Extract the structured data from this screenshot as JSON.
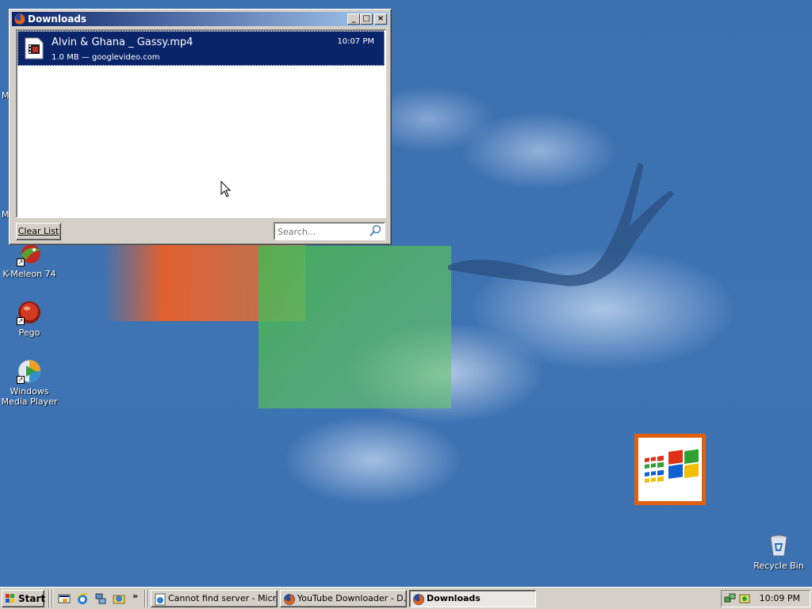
{
  "window": {
    "title": "Downloads",
    "controls": {
      "minimize": "_",
      "maximize": "□",
      "close": "×"
    },
    "download": {
      "filename": "Alvin & Ghana _ Gassy.mp4",
      "meta": "1.0 MB — googlevideo.com",
      "time": "10:07 PM"
    },
    "clear_button": "Clear List",
    "search_placeholder": "Search..."
  },
  "desktop_icons": [
    {
      "label": "K-Meleon 74",
      "icon": "k-meleon-icon"
    },
    {
      "label": "Pego",
      "icon": "pego-icon"
    },
    {
      "label": "Windows Media Player",
      "icon": "media-player-icon"
    },
    {
      "label": "Recycle Bin",
      "icon": "recycle-bin-icon"
    }
  ],
  "edge_letters": [
    "M",
    "M"
  ],
  "taskbar": {
    "start_label": "Start",
    "quick_launch": [
      "show-desktop-icon",
      "internet-explorer-icon",
      "network-icon",
      "outlook-icon"
    ],
    "chevron": "»",
    "tasks": [
      {
        "label": "Cannot find server - Micr...",
        "icon": "ie-page-icon",
        "active": false
      },
      {
        "label": "YouTube Downloader - D...",
        "icon": "firefox-icon",
        "active": false
      },
      {
        "label": "Downloads",
        "icon": "firefox-icon",
        "active": true
      }
    ],
    "clock": "10:09 PM"
  },
  "colors": {
    "desktop": "#3a6ea5",
    "title_active_start": "#0a246a",
    "title_active_end": "#a6caf0",
    "selection": "#0a246a",
    "face": "#d4d0c8"
  }
}
